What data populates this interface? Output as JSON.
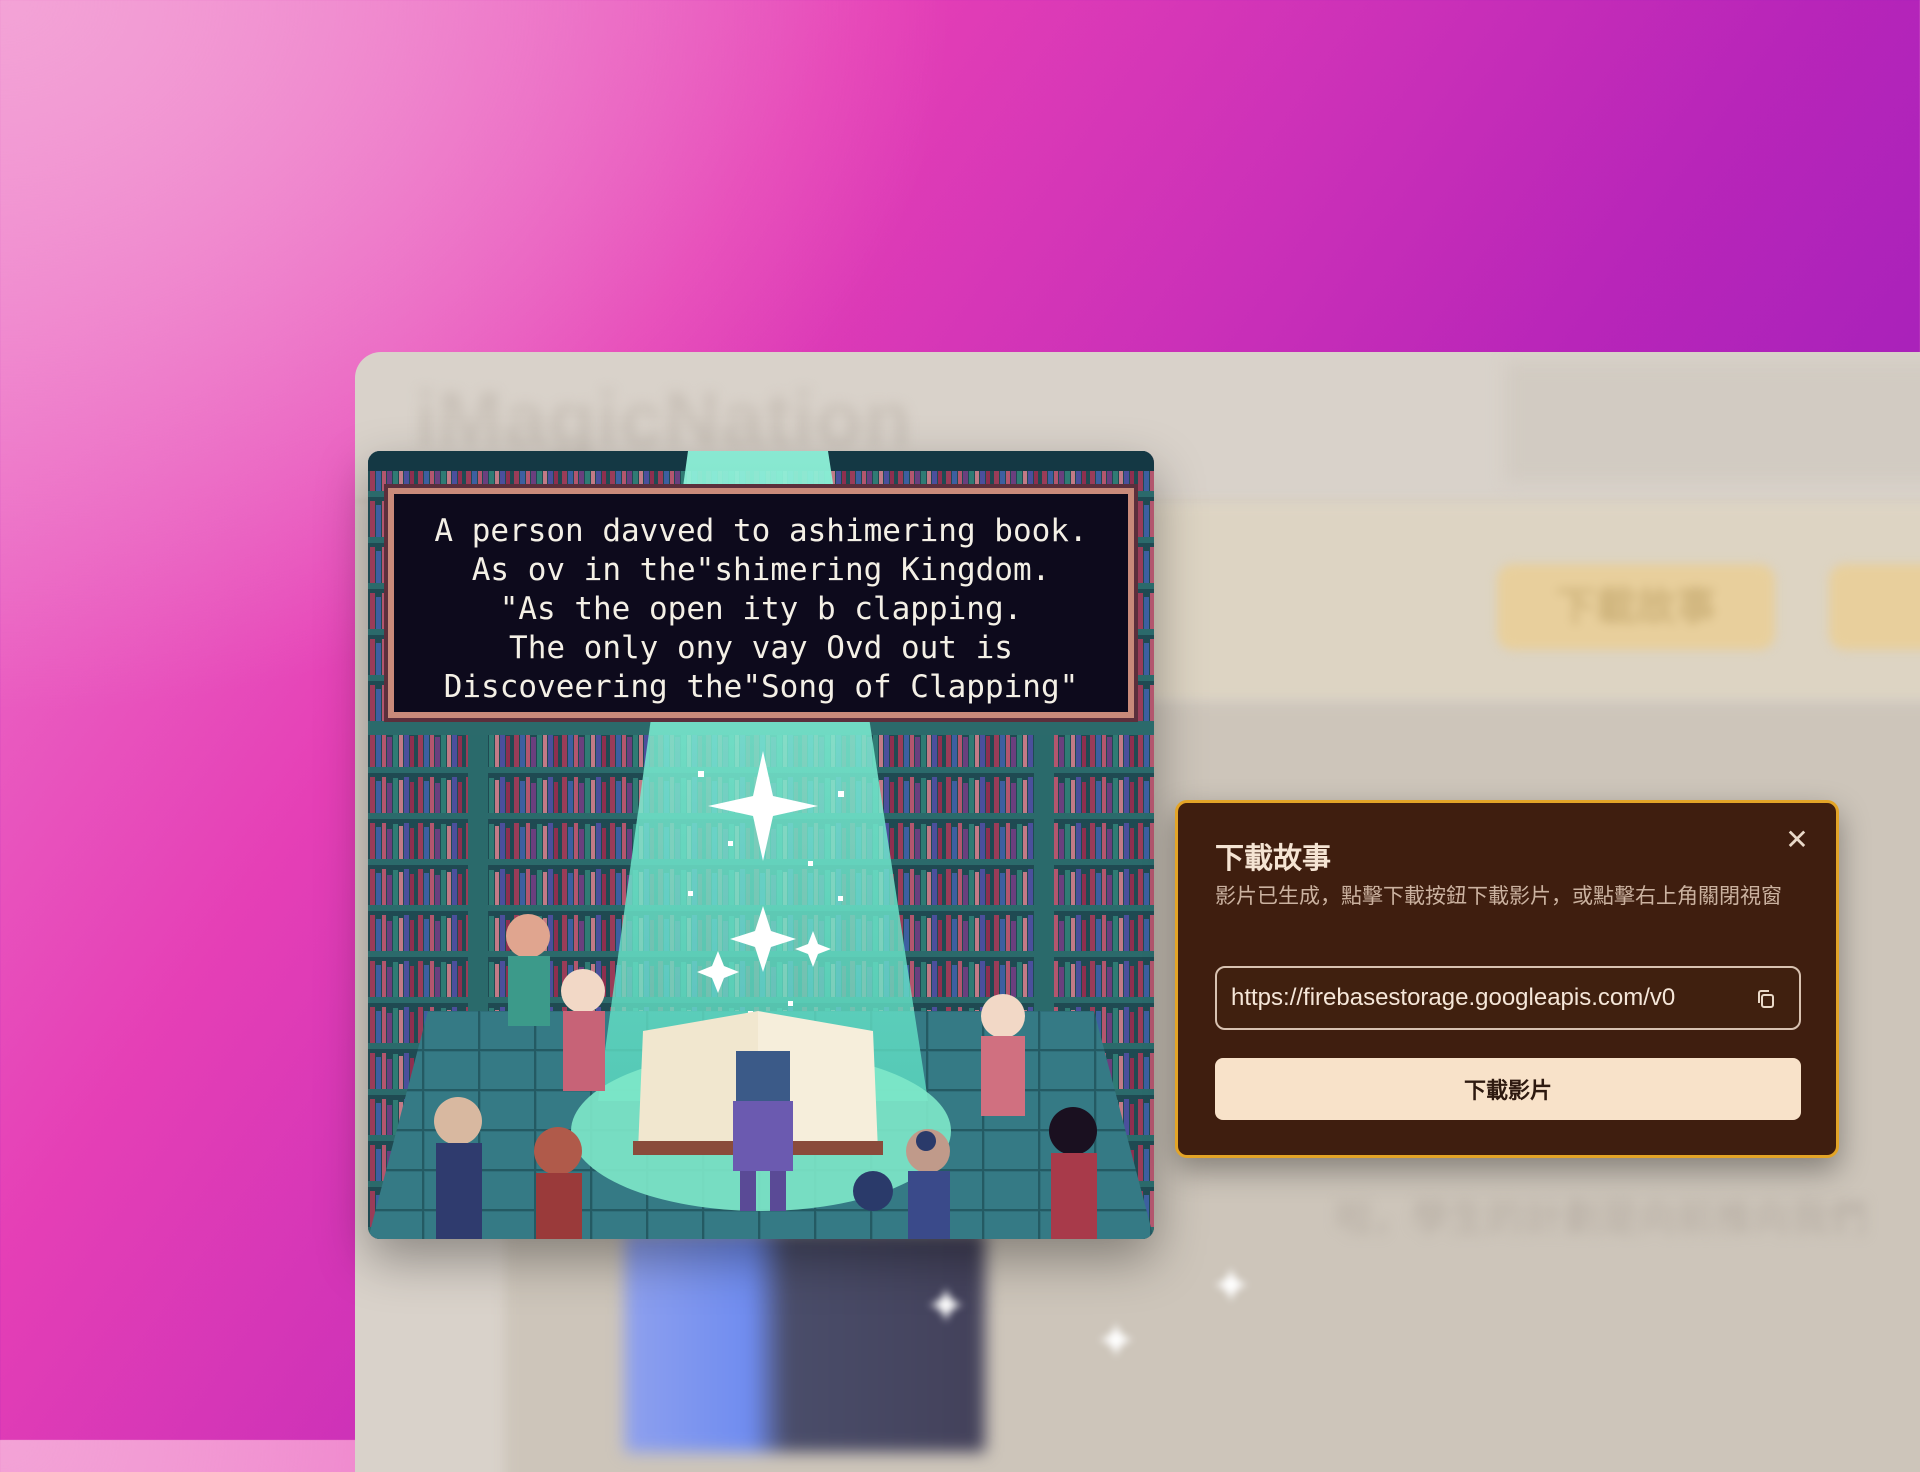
{
  "background_app": {
    "title": "iMagicNation",
    "button_label": "下載故事",
    "blurred_text": "啦，學生的計劃是向前推向我們"
  },
  "story_image": {
    "caption": "A person davved to ashimering book.\nAs ov in the\"shimering Kingdom.\n\"As the open ity b clapping.\nThe only ony vay Ovd out is\nDiscoveering the\"Song of Clapping\""
  },
  "dialog": {
    "title": "下載故事",
    "description": "影片已生成，點擊下載按鈕下載影片，或點擊右上角關閉視窗",
    "url_value": "https://firebasestorage.googleapis.com/v0",
    "download_label": "下載影片",
    "close_icon": "close-icon",
    "copy_icon": "copy-icon"
  },
  "colors": {
    "dialog_bg": "#3f1e0f",
    "dialog_border": "#e3a427",
    "button_bg": "#f8e2c9"
  }
}
